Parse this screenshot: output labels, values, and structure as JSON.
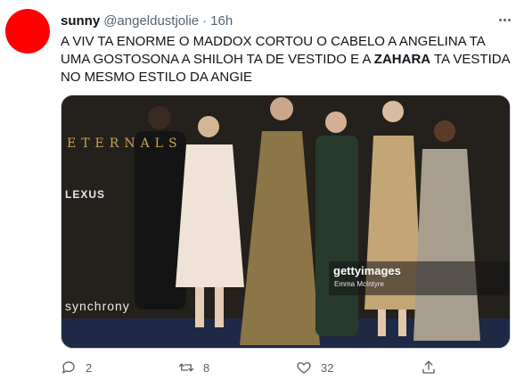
{
  "user": {
    "name": "sunny",
    "handle": "@angeldustjolie",
    "separator": "·",
    "time": "16h",
    "avatar_color": "#ff0000"
  },
  "tweet": {
    "text_part1": "A VIV TA ENORME O MADDOX CORTOU O CABELO A ANGELINA TA UMA GOSTOSONA A SHILOH TA DE VESTIDO E A ",
    "text_bold": "ZAHARA",
    "text_part2": " TA VESTIDA NO MESMO ESTILO DA ANGIE"
  },
  "photo": {
    "watermark_logo": "gettyimages",
    "watermark_credit": "Emma McIntyre",
    "backdrop_texts": [
      "ETERNALS",
      "LEXUS",
      "synchrony"
    ]
  },
  "actions": {
    "reply_count": "2",
    "retweet_count": "8",
    "like_count": "32"
  },
  "icons": [
    "more-dots-icon",
    "reply-icon",
    "retweet-icon",
    "like-icon",
    "share-icon"
  ]
}
